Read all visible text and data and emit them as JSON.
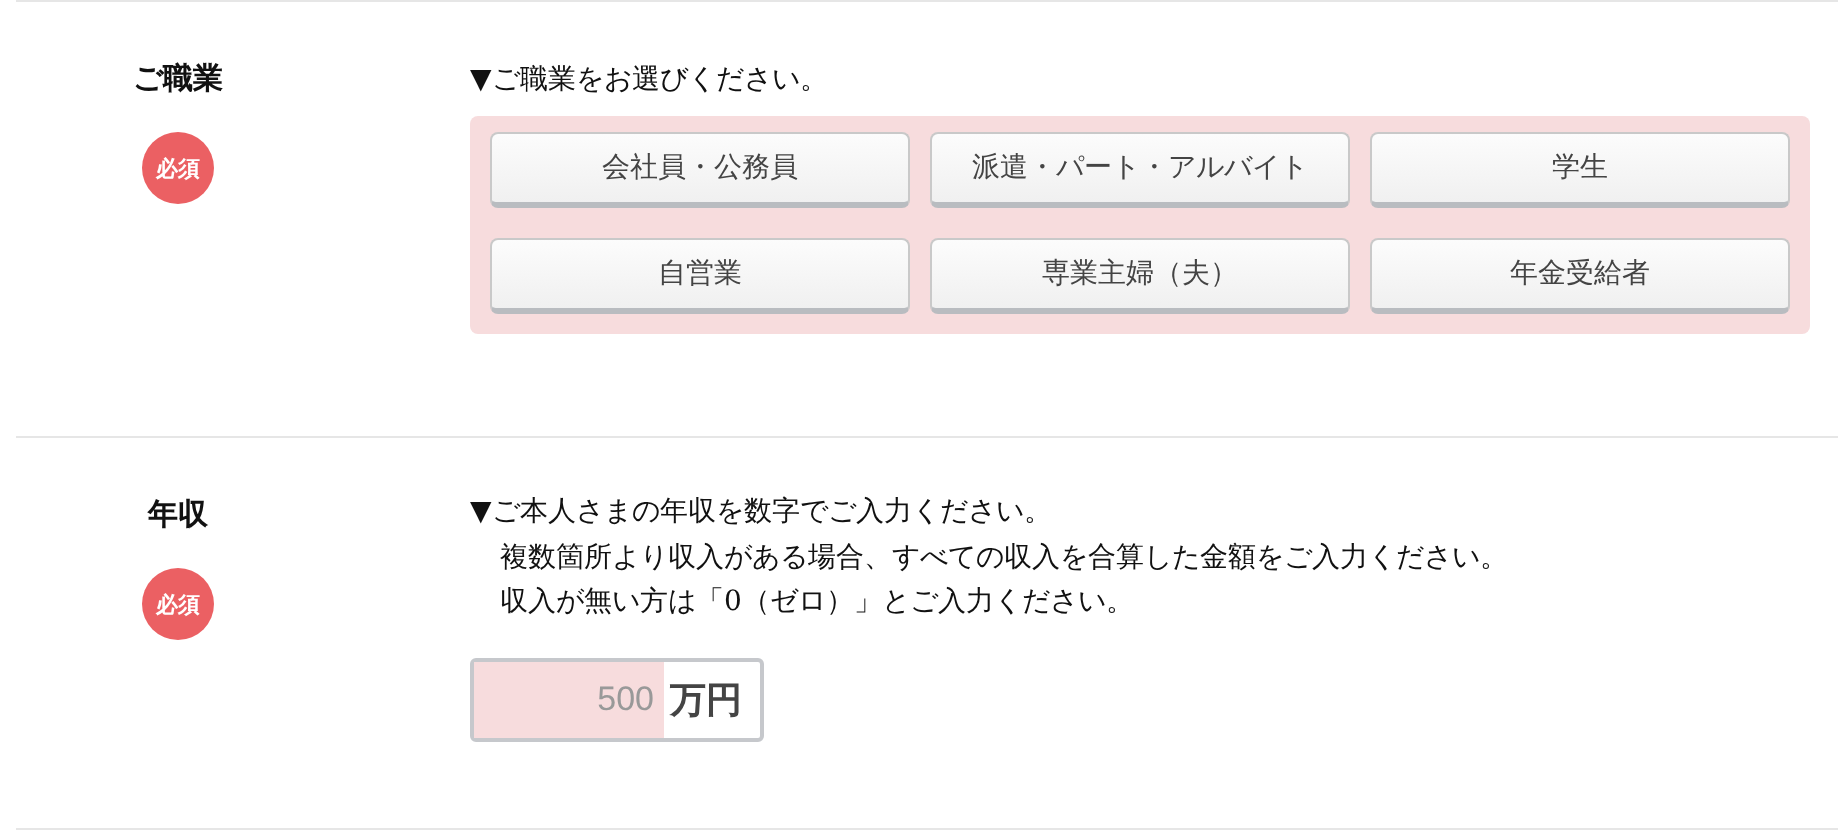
{
  "sections": [
    {
      "kind": "choices",
      "label": "ご職業",
      "badge": "必須",
      "instructions": [
        "▼ご職業をお選びください。"
      ],
      "options": [
        {
          "label": "会社員・公務員",
          "selected": false
        },
        {
          "label": "派遣・パート・アルバイト",
          "selected": false
        },
        {
          "label": "学生",
          "selected": false
        },
        {
          "label": "自営業",
          "selected": false
        },
        {
          "label": "専業主婦（夫）",
          "selected": false
        },
        {
          "label": "年金受給者",
          "selected": false
        }
      ]
    },
    {
      "kind": "number",
      "label": "年収",
      "badge": "必須",
      "instructions": [
        "▼ご本人さまの年収を数字でご入力ください。",
        "複数箇所より収入がある場合、すべての収入を合算した金額をご入力ください。",
        "収入が無い方は「0（ゼロ）」とご入力ください。"
      ],
      "input": {
        "placeholder": "500",
        "unit": "万円"
      }
    }
  ]
}
